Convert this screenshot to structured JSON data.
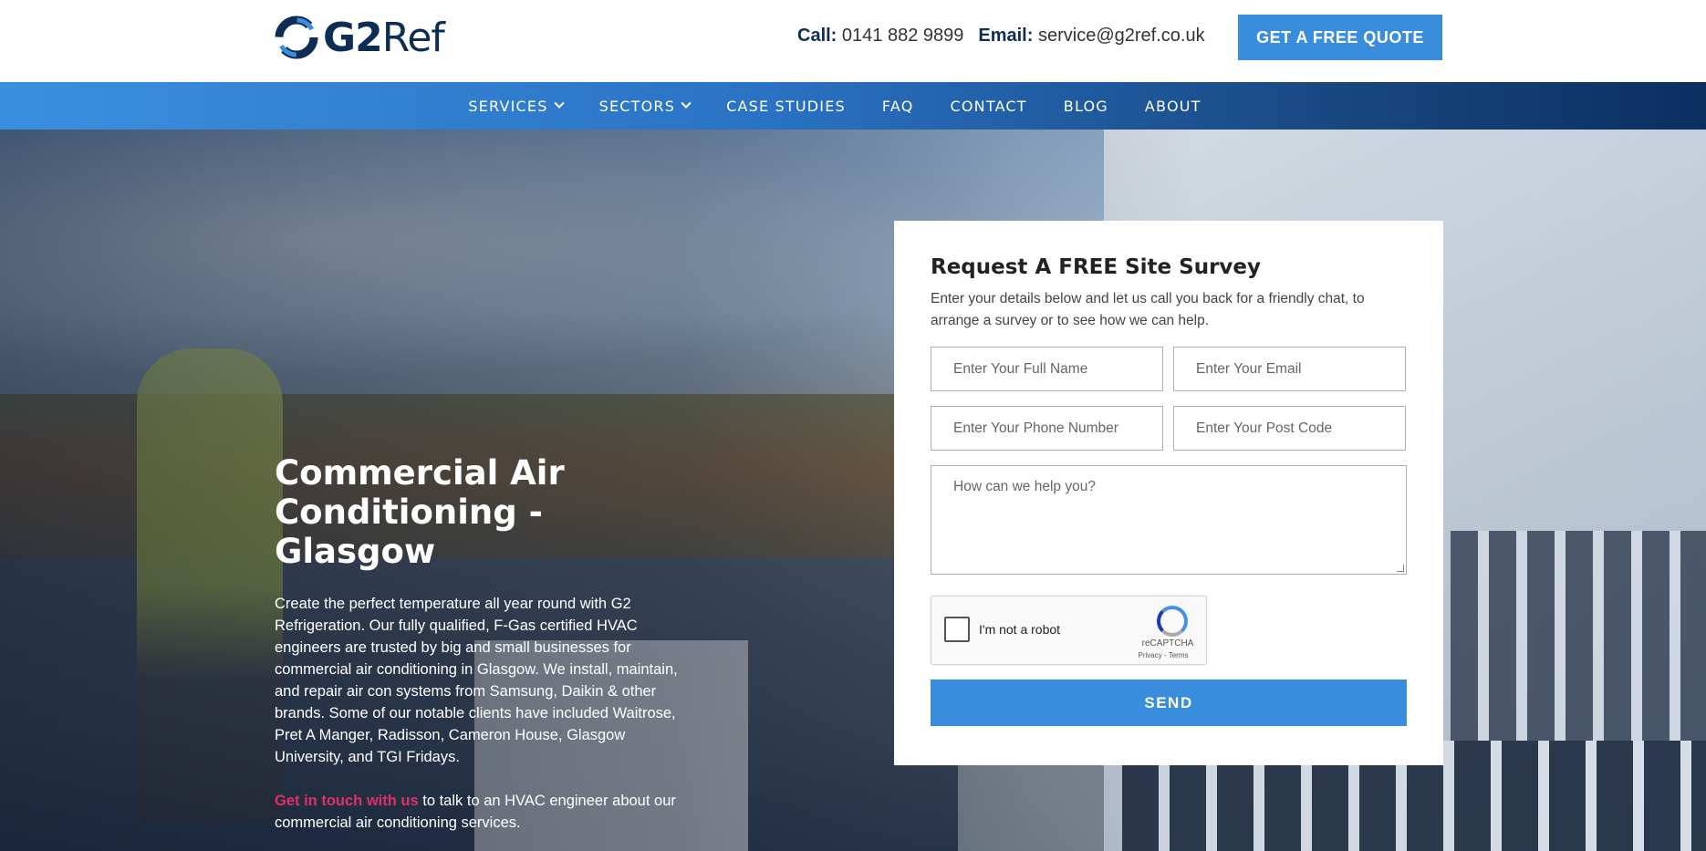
{
  "header": {
    "logo_prefix": "G2",
    "logo_suffix": "Ref",
    "call_label": "Call:",
    "call_value": "0141 882 9899",
    "email_label": "Email:",
    "email_value": "service@g2ref.co.uk",
    "quote_button": "GET A FREE QUOTE"
  },
  "nav": {
    "items": [
      {
        "label": "SERVICES",
        "has_dropdown": true
      },
      {
        "label": "SECTORS",
        "has_dropdown": true
      },
      {
        "label": "CASE STUDIES",
        "has_dropdown": false
      },
      {
        "label": "FAQ",
        "has_dropdown": false
      },
      {
        "label": "CONTACT",
        "has_dropdown": false
      },
      {
        "label": "BLOG",
        "has_dropdown": false
      },
      {
        "label": "ABOUT",
        "has_dropdown": false
      }
    ]
  },
  "hero": {
    "title": "Commercial Air Conditioning - Glasgow",
    "body": "Create the perfect temperature all year round with G2 Refrigeration. Our fully qualified, F-Gas certified HVAC engineers are trusted by big and small businesses for commercial air conditioning in Glasgow. We install, maintain, and repair air con systems from Samsung, Daikin & other brands. Some of our notable clients have included Waitrose, Pret A Manger, Radisson, Cameron House, Glasgow University, and TGI Fridays.",
    "cta_link": "Get in touch with us",
    "cta_text": " to talk to an HVAC engineer about our commercial air conditioning services."
  },
  "form": {
    "title": "Request A FREE Site Survey",
    "subtitle": "Enter your details below and let us call you back for a friendly chat, to arrange a survey or to see how we can help.",
    "name_placeholder": "Enter Your Full Name",
    "email_placeholder": "Enter Your Email",
    "phone_placeholder": "Enter Your Phone Number",
    "postcode_placeholder": "Enter Your Post Code",
    "message_placeholder": "How can we help you?",
    "captcha_label": "I'm not a robot",
    "captcha_brand": "reCAPTCHA",
    "captcha_terms": "Privacy - Terms",
    "send_button": "SEND"
  },
  "colors": {
    "accent": "#3a8ddc",
    "brand_dark": "#0d2d55",
    "link_pink": "#e0306a"
  }
}
